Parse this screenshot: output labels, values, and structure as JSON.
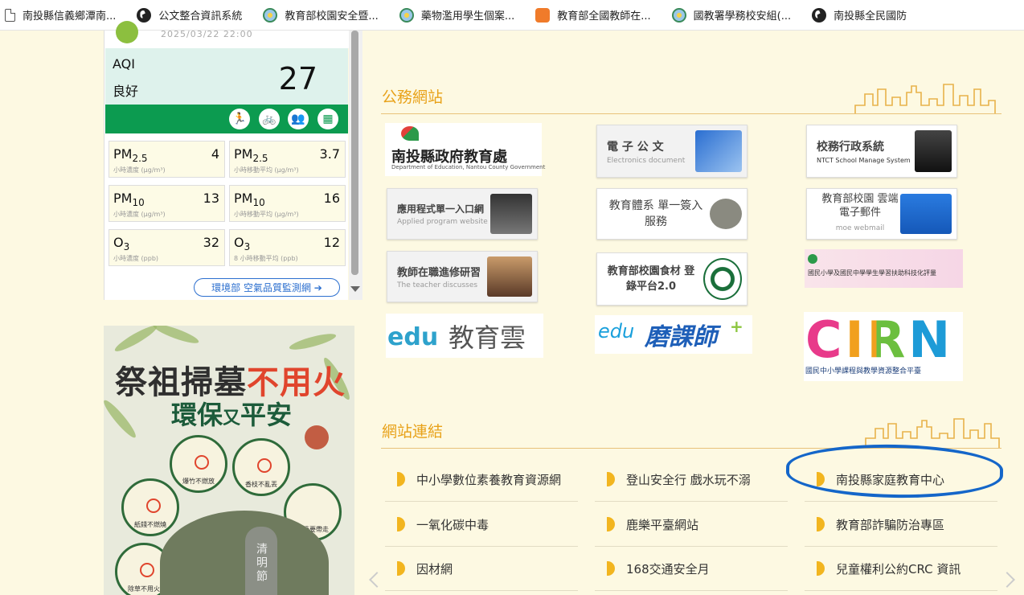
{
  "bookmarks": [
    {
      "label": "南投縣信義鄉潭南...",
      "icon": "page-icon"
    },
    {
      "label": "公文整合資訊系統",
      "icon": "globe-icon"
    },
    {
      "label": "教育部校園安全暨...",
      "icon": "moe-emblem-icon"
    },
    {
      "label": "藥物濫用學生個案...",
      "icon": "moe-emblem-icon"
    },
    {
      "label": "教育部全國教師在...",
      "icon": "orange-app-icon"
    },
    {
      "label": "國教署學務校安組(...",
      "icon": "moe-emblem-icon"
    },
    {
      "label": "南投縣全民國防",
      "icon": "globe-icon"
    }
  ],
  "aqi": {
    "timestamp": "2025/03/22 22:00",
    "label": "AQI",
    "status": "良好",
    "value": "27",
    "status_color": "#0c9b50",
    "activity_icons": [
      "running-icon",
      "bicycle-icon",
      "group-icon",
      "window-icon"
    ],
    "readings": [
      {
        "name": "PM",
        "sub": "2.5",
        "value": "4",
        "unit": "小時濃度 (μg/m³)"
      },
      {
        "name": "PM",
        "sub": "2.5",
        "value": "3.7",
        "unit": "小時移動平均 (μg/m³)"
      },
      {
        "name": "PM",
        "sub": "10",
        "value": "13",
        "unit": "小時濃度 (μg/m³)"
      },
      {
        "name": "PM",
        "sub": "10",
        "value": "16",
        "unit": "小時移動平均 (μg/m³)"
      },
      {
        "name": "O",
        "sub": "3",
        "value": "32",
        "unit": "小時濃度 (ppb)"
      },
      {
        "name": "O",
        "sub": "3",
        "value": "12",
        "unit": "8 小時移動平均 (ppb)"
      }
    ],
    "link_label": "環境部 空氣品質監測網"
  },
  "poster": {
    "title_a": "祭祖掃墓",
    "title_b": "不用火",
    "subtitle_a": "環保",
    "subtitle_mid": "又",
    "subtitle_b": "平安",
    "items": [
      "爆竹不燃放",
      "香枝不亂丟",
      "紙錢不燃燒",
      "垃圾要帶走",
      "除草不用火"
    ],
    "tomb_text": "清明節"
  },
  "official": {
    "title": "公務網站",
    "logos": [
      {
        "title": "南投縣政府教育處",
        "sub": "Department of Education, Nantou County Government"
      },
      {
        "title": "電 子 公 文",
        "sub": "Electronics document"
      },
      {
        "title": "校務行政系統",
        "sub": "NTCT School Manage System"
      },
      {
        "title": "應用程式單一入口網",
        "sub": "Applied program website"
      },
      {
        "title": "教育體系 單一簽入服務",
        "sub": ""
      },
      {
        "title": "教育部校園 雲端電子郵件",
        "sub": "moe webmail"
      },
      {
        "title": "教師在職進修研習",
        "sub": "The teacher discusses"
      },
      {
        "title": "教育部校園食材 登錄平台2.0",
        "sub": ""
      },
      {
        "title": "國民小學及國民中學學生學習扶助科技化評量",
        "sub": ""
      },
      {
        "title": "教育雲",
        "sub": "edu"
      },
      {
        "title": "磨課師",
        "sub": "edu"
      },
      {
        "title": "CIRN",
        "sub": "國民中小學課程與教學資源整合平臺"
      }
    ]
  },
  "links": {
    "title": "網站連結",
    "items": [
      "中小學數位素養教育資源網",
      "登山安全行 戲水玩不溺",
      "南投縣家庭教育中心",
      "一氧化碳中毒",
      "鹿樂平臺網站",
      "教育部詐騙防治專區",
      "因材網",
      "168交通安全月",
      "兒童權利公約CRC 資訊"
    ]
  }
}
